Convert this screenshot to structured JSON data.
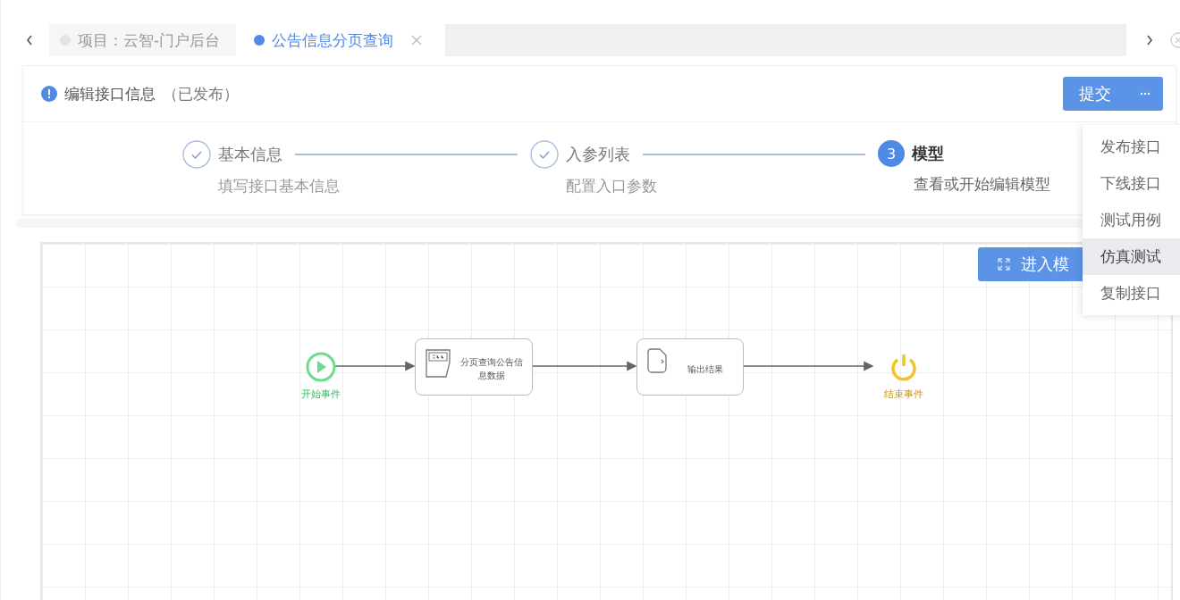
{
  "tabs": [
    {
      "label": "项目：云智-门户后台",
      "selected": false
    },
    {
      "label": "公告信息分页查询",
      "selected": true
    }
  ],
  "header": {
    "title": "编辑接口信息",
    "status": "（已发布）",
    "submit": "提交"
  },
  "steps": [
    {
      "title": "基本信息",
      "description": "填写接口基本信息",
      "kind": "done"
    },
    {
      "title": "入参列表",
      "description": "配置入口参数",
      "kind": "done"
    },
    {
      "number": "3",
      "title": "模型",
      "description": "查看或开始编辑模型",
      "kind": "current"
    }
  ],
  "menu": [
    {
      "label": "发布接口",
      "selected": false
    },
    {
      "label": "下线接口",
      "selected": false
    },
    {
      "label": "测试用例",
      "selected": false
    },
    {
      "label": "仿真测试",
      "selected": true
    },
    {
      "label": "复制接口",
      "selected": false
    }
  ],
  "canvas": {
    "enter_button": "进入模",
    "nodes": [
      {
        "kind": "start",
        "label": "开始事件"
      },
      {
        "kind": "sql",
        "label": "分页查询公告信息数据"
      },
      {
        "kind": "output",
        "label": "输出结果"
      },
      {
        "kind": "end",
        "label": "结束事件"
      }
    ]
  }
}
